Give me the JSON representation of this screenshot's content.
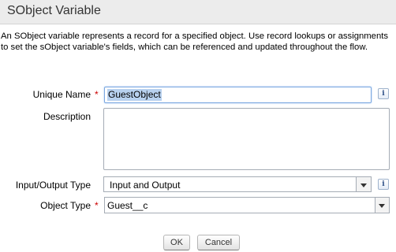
{
  "dialog": {
    "title": "SObject Variable",
    "description": "An SObject variable represents a record for a specified object. Use record lookups or assignments to set the sObject variable's fields, which can be referenced and updated throughout the flow."
  },
  "form": {
    "unique_name": {
      "label": "Unique Name",
      "required_mark": "*",
      "value": "GuestObject",
      "info_icon": "i"
    },
    "description": {
      "label": "Description",
      "value": ""
    },
    "io_type": {
      "label": "Input/Output Type",
      "value": "Input and Output",
      "info_icon": "i"
    },
    "object_type": {
      "label": "Object Type",
      "required_mark": "*",
      "value": "Guest__c"
    }
  },
  "buttons": {
    "ok": "OK",
    "cancel": "Cancel"
  },
  "icons": {
    "info": "info-icon",
    "dropdown": "chevron-down-icon"
  },
  "colors": {
    "required": "#cc0000",
    "selection": "#b8d1ef",
    "header_bg": "#ececec"
  }
}
